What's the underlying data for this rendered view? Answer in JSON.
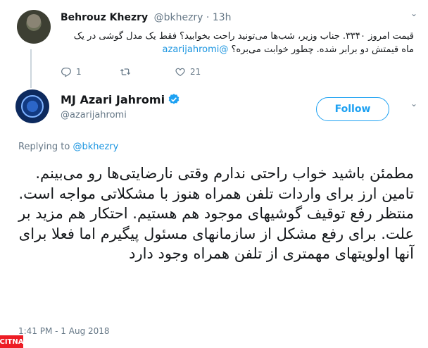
{
  "parent_tweet": {
    "name": "Behrouz Khezry",
    "handle": "@bkhezry",
    "time": "13h",
    "separator": " · ",
    "text": "قیمت امروز ۳۳۴۰. جناب وزیر، شب‌ها می‌تونید راحت بخوابید؟ فقط یک مدل گوشی در یک ماه قیمتش دو برابر شده. چطور خوابت می‌بره؟",
    "mention": "@azarijahromi",
    "replies": "1",
    "retweets": "",
    "likes": "21"
  },
  "main_tweet": {
    "name": "MJ Azari Jahromi",
    "handle": "@azarijahromi",
    "follow_label": "Follow",
    "replying_prefix": "Replying to",
    "replying_to": "@bkhezry",
    "text": "مطمئن باشید خواب راحتی ندارم وقتی نارضایتی‌ها رو می‌بینم. تامین ارز برای واردات تلفن همراه هنوز با مشکلاتی مواجه است. منتظر رفع توقیف گوشیهای موجود هم هستیم. احتکار هم مزید بر علت. برای رفع مشکل از سازمانهای مسئول پیگیرم اما فعلا برای آنها اولویتهای مهمتری از تلفن همراه وجود دارد",
    "timestamp": "1:41 PM - 1 Aug 2018"
  },
  "watermark": "CITNA",
  "colors": {
    "accent": "#1da1f2",
    "mention": "#1b95e0",
    "muted": "#657786",
    "watermark_bg": "#ed1c24"
  },
  "icons": [
    "reply-icon",
    "retweet-icon",
    "like-icon",
    "verified-badge-icon",
    "chevron-down-icon"
  ]
}
